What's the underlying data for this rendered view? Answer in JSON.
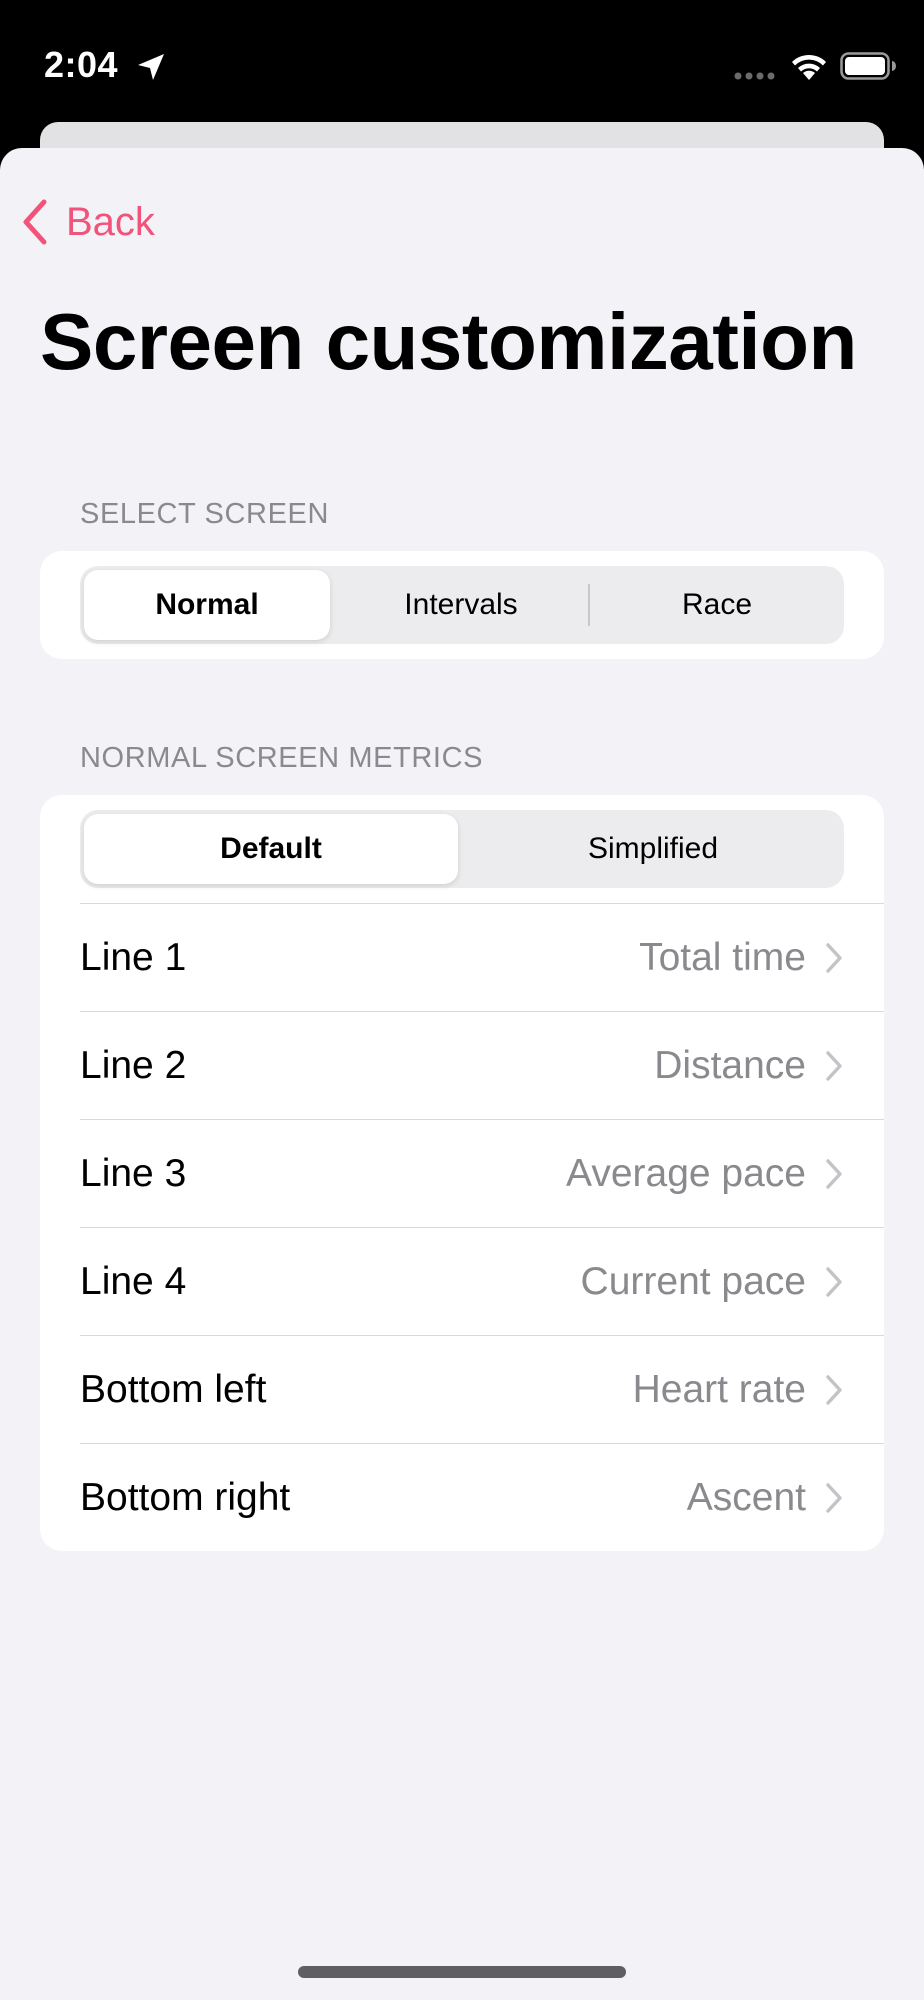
{
  "status_bar": {
    "time": "2:04"
  },
  "nav": {
    "back_label": "Back",
    "accent_color": "#f2537a"
  },
  "page": {
    "title": "Screen customization"
  },
  "select_screen": {
    "header": "SELECT SCREEN",
    "segments": [
      {
        "label": "Normal",
        "selected": true
      },
      {
        "label": "Intervals",
        "selected": false
      },
      {
        "label": "Race",
        "selected": false
      }
    ]
  },
  "metrics": {
    "header": "NORMAL SCREEN METRICS",
    "segments": [
      {
        "label": "Default",
        "selected": true
      },
      {
        "label": "Simplified",
        "selected": false
      }
    ],
    "rows": [
      {
        "label": "Line 1",
        "value": "Total time"
      },
      {
        "label": "Line 2",
        "value": "Distance"
      },
      {
        "label": "Line 3",
        "value": "Average pace"
      },
      {
        "label": "Line 4",
        "value": "Current pace"
      },
      {
        "label": "Bottom left",
        "value": "Heart rate"
      },
      {
        "label": "Bottom right",
        "value": "Ascent"
      }
    ]
  },
  "icons": {
    "status_location": "location-arrow-icon",
    "status_signal": "cellular-signal-icon",
    "status_wifi": "wifi-icon",
    "status_battery": "battery-icon",
    "back": "chevron-left-icon",
    "row_disclosure": "chevron-right-icon"
  }
}
